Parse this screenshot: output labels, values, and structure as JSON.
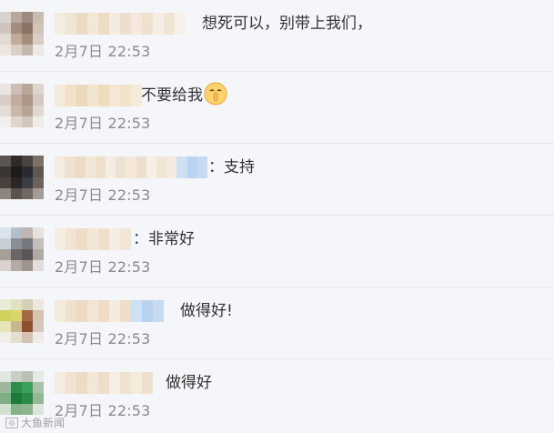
{
  "comments": [
    {
      "text": "想死可以，别带上我们，",
      "time": "2月7日 22:53",
      "avatar_colors": [
        "#d8d3cf",
        "#b7a89c",
        "#9e8b80",
        "#c9bcb2",
        "#cfc5bd",
        "#a38c7e",
        "#8b7466",
        "#d2c4b6",
        "#e2dbd4",
        "#c1ab9a",
        "#a48d7c",
        "#d7cdc4",
        "#ebe6e2",
        "#d9cfc6",
        "#c7b8ac",
        "#ede9e6"
      ],
      "name_colors": [
        "#f3ece3",
        "#f1e5d6",
        "#ead9c3",
        "#f3e7d8",
        "#ecdcc6",
        "#f5ece1",
        "#eedfcc",
        "#f4e9dc",
        "#efe1ce",
        "#f6eee4",
        "#f0e4d4",
        "#f7f1e9"
      ]
    },
    {
      "text": "不要给我",
      "has_emoji": true,
      "time": "2月7日 22:53",
      "avatar_colors": [
        "#e9e5e1",
        "#cdbfb5",
        "#b9a799",
        "#ded5cd",
        "#d9cec6",
        "#c2aca0",
        "#ad9688",
        "#d6c9bf",
        "#e4dcd6",
        "#c9b7ac",
        "#b8a395",
        "#e1d8d1",
        "#f1eeeb",
        "#e0d6ce",
        "#d3c6bc",
        "#f0ece8"
      ],
      "name_colors": [
        "#f3ead9",
        "#f0e1c7",
        "#ecd9b9",
        "#f2e5cf",
        "#eedcbd",
        "#f4e8d4",
        "#f1e2c8",
        "#f5ebda"
      ]
    },
    {
      "text": "：支持",
      "time": "2月7日 22:53",
      "avatar_colors": [
        "#5b5552",
        "#2f2b2a",
        "#4a4340",
        "#7a716b",
        "#3a3432",
        "#1e1b1b",
        "#2b2a2e",
        "#5e5650",
        "#47403c",
        "#2a2626",
        "#3b3d47",
        "#6a625b",
        "#8d857e",
        "#5a524d",
        "#6f6760",
        "#a39b94"
      ],
      "name_colors": [
        "#f4ece2",
        "#f0e2d0",
        "#ecdcc6",
        "#f2e6d6",
        "#eedfcb",
        "#f5ede3",
        "#efe2d1",
        "#f3e8da",
        "#edded0",
        "#f6efe6",
        "#f1e5d6",
        "#f4eadf",
        "#cfe0f3",
        "#b9d3f0",
        "#c5dbf4"
      ]
    },
    {
      "text": "：非常好",
      "time": "2月7日 22:53",
      "avatar_colors": [
        "#dbe3ec",
        "#b4bfcc",
        "#c0b7b2",
        "#e6e2df",
        "#c8cfd7",
        "#8b8e95",
        "#76787e",
        "#c3bfbc",
        "#a89e98",
        "#6b6566",
        "#5a5557",
        "#b2aaa6",
        "#d9d2ce",
        "#b3aaa5",
        "#9d948f",
        "#e3dedb"
      ],
      "name_colors": [
        "#f4ede4",
        "#f1e4d4",
        "#eddcc6",
        "#f3e7d8",
        "#efe0cc",
        "#f6eee4",
        "#f2e5d5"
      ]
    },
    {
      "text": "做得好!",
      "time": "2月7日 22:53",
      "avatar_colors": [
        "#e8ebd8",
        "#e0e3c0",
        "#d6d0b8",
        "#ece8e0",
        "#cfd25a",
        "#d9d66a",
        "#a46a45",
        "#d8c3b1",
        "#e6e4b8",
        "#c6b78e",
        "#8d4f2f",
        "#d6c7ba",
        "#f0eee6",
        "#e7ded2",
        "#d4c3b3",
        "#efebe6"
      ],
      "name_colors": [
        "#f4ebdf",
        "#f0e1cd",
        "#ecdac3",
        "#f2e5d3",
        "#eedcc5",
        "#f5ece0",
        "#efdfca",
        "#cde1f5",
        "#b8d2f0",
        "#c7dbf3"
      ]
    },
    {
      "text": "做得好",
      "time": "2月7日 22:53",
      "avatar_colors": [
        "#e3e7e1",
        "#c7d0c4",
        "#b9c1b5",
        "#e6e9e4",
        "#9db89c",
        "#2f8d4a",
        "#3aa05a",
        "#a9c3a8",
        "#7fae82",
        "#1e7a3b",
        "#2a8b47",
        "#93b894",
        "#d3e0d2",
        "#86b086",
        "#8fb48f",
        "#dbe5da"
      ],
      "name_colors": [
        "#f4ece2",
        "#f1e3d1",
        "#ecdbc5",
        "#f3e7d7",
        "#eeddc8",
        "#f6eee4",
        "#f0e2cf",
        "#f5ebdd",
        "#efe0ce"
      ]
    }
  ],
  "watermark": {
    "icon": "camera-icon",
    "text": "大鱼新闻"
  }
}
